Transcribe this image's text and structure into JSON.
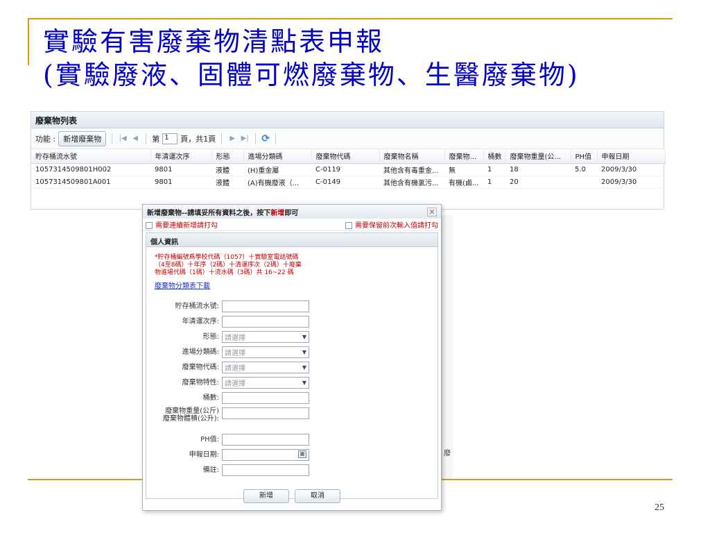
{
  "slide": {
    "title_line1": "實驗有害廢棄物清點表申報",
    "title_line2": "(實驗廢液、固體可燃廢棄物、生醫廢棄物)",
    "page_number": "25"
  },
  "list": {
    "title": "廢棄物列表",
    "toolbar": {
      "function_label": "功能 :",
      "add_button": "新增廢棄物",
      "page_prefix": "第",
      "page_value": "1",
      "page_suffix": "頁，共1頁"
    },
    "columns": [
      "貯存桶流水號",
      "年清運次序",
      "形態",
      "進場分類碼",
      "廢棄物代碼",
      "廢棄物名稱",
      "廢棄物...",
      "桶數",
      "廢棄物重量(公...",
      "PH值",
      "申報日期"
    ],
    "rows": [
      [
        "1057314509801H002",
        "9801",
        "液體",
        "(H)重金屬",
        "C-0119",
        "其他含有毒重金...",
        "無",
        "1",
        "18",
        "5.0",
        "2009/3/30"
      ],
      [
        "1057314509801A001",
        "9801",
        "液體",
        "(A)有機廢液（...",
        "C-0149",
        "其他含有機氯污...",
        "有機(鹵...",
        "1",
        "20",
        "",
        "2009/3/30"
      ]
    ]
  },
  "dialog": {
    "header_prefix": "新增廢棄物--請填妥所有資料之後，按下",
    "header_highlight": "新增",
    "header_suffix": "即可",
    "check_left": "需要連續新增請打勾",
    "check_right": "需要保留前次輸入值請打勾",
    "panel_title": "個人資訊",
    "note": "*貯存桶編號爲學校代碼（1057）十實驗室電話號碼（4至8碼）十年序（2碼）十清運序次（2碼）十廢棄物進場代碼（1碼）十流水碼（3碼）共 16~22 碼",
    "download_link": "廢棄物分類表下載",
    "fields": {
      "barrel_no": {
        "label": "貯存桶流水號:"
      },
      "yearly_order": {
        "label": "年清運次序:"
      },
      "form_type": {
        "label": "形態:",
        "placeholder": "請選擇"
      },
      "entry_code": {
        "label": "進場分類碼:",
        "placeholder": "請選擇"
      },
      "waste_code": {
        "label": "廢棄物代碼:",
        "placeholder": "請選擇"
      },
      "waste_property": {
        "label": "廢棄物特性:",
        "placeholder": "請選擇"
      },
      "barrel_count": {
        "label": "桶數:"
      },
      "weight": {
        "label": "廢棄物重量(公斤)",
        "label2": "廢棄物體積(公升):"
      },
      "ph": {
        "label": "PH值:"
      },
      "report_date": {
        "label": "申報日期:"
      },
      "remarks": {
        "label": "備註:"
      }
    },
    "submit": "新增",
    "cancel": "取消"
  },
  "background_fragment": "廢"
}
